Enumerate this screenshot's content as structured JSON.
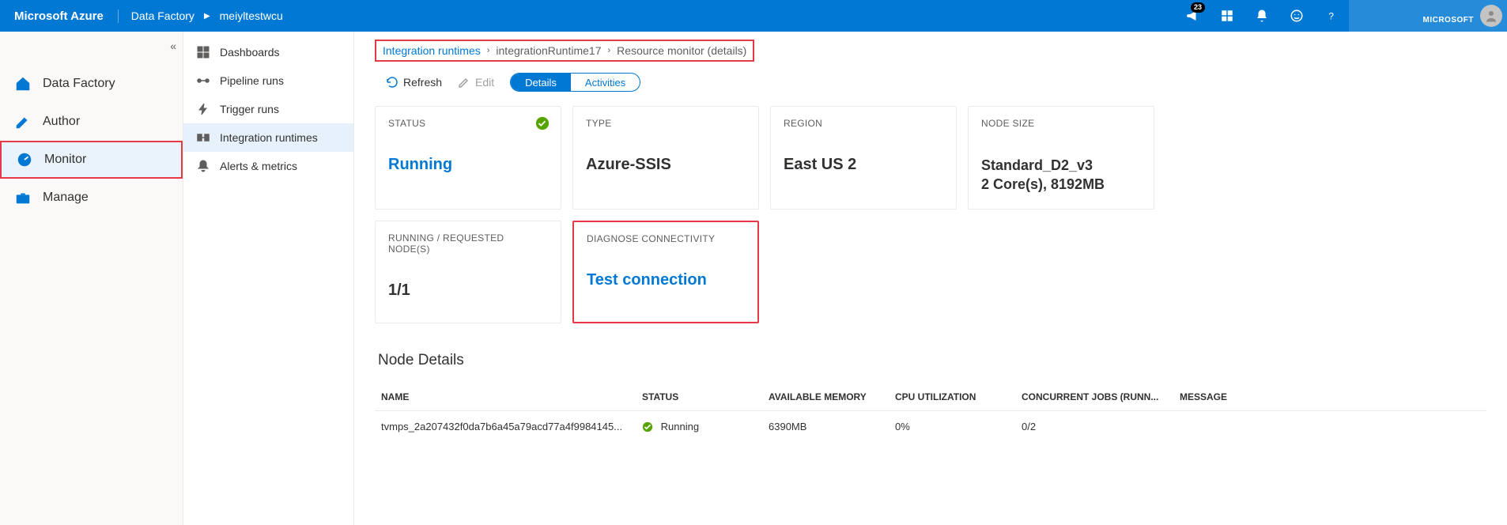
{
  "topbar": {
    "brand": "Microsoft Azure",
    "crumb1": "Data Factory",
    "crumb2": "meiyltestwcu",
    "notif_badge": "23",
    "tenant": "MICROSOFT"
  },
  "leftnav": {
    "items": [
      {
        "icon": "home",
        "label": "Data Factory"
      },
      {
        "icon": "pencil",
        "label": "Author"
      },
      {
        "icon": "gauge",
        "label": "Monitor",
        "active": true
      },
      {
        "icon": "toolbox",
        "label": "Manage"
      }
    ]
  },
  "subnav": {
    "items": [
      {
        "icon": "grid",
        "label": "Dashboards"
      },
      {
        "icon": "pipeline",
        "label": "Pipeline runs"
      },
      {
        "icon": "bolt",
        "label": "Trigger runs"
      },
      {
        "icon": "ir",
        "label": "Integration runtimes",
        "active": true
      },
      {
        "icon": "bell",
        "label": "Alerts & metrics"
      }
    ]
  },
  "breadcrumb": {
    "l1": "Integration runtimes",
    "l2": "integrationRuntime17",
    "l3": "Resource monitor (details)"
  },
  "toolbar": {
    "refresh": "Refresh",
    "edit": "Edit",
    "details": "Details",
    "activities": "Activities"
  },
  "cards": {
    "status_label": "STATUS",
    "status_value": "Running",
    "type_label": "TYPE",
    "type_value": "Azure-SSIS",
    "region_label": "REGION",
    "region_value": "East US 2",
    "nodesize_label": "NODE SIZE",
    "nodesize_value1": "Standard_D2_v3",
    "nodesize_value2": "2 Core(s), 8192MB",
    "runreq_label": "RUNNING / REQUESTED NODE(S)",
    "runreq_value": "1/1",
    "diag_label": "DIAGNOSE CONNECTIVITY",
    "diag_value": "Test connection"
  },
  "node_section_title": "Node Details",
  "node_table": {
    "headers": {
      "name": "NAME",
      "status": "STATUS",
      "mem": "AVAILABLE MEMORY",
      "cpu": "CPU UTILIZATION",
      "jobs": "CONCURRENT JOBS (RUNN...",
      "msg": "MESSAGE"
    },
    "rows": [
      {
        "name": "tvmps_2a207432f0da7b6a45a79acd77a4f9984145...",
        "status": "Running",
        "mem": "6390MB",
        "cpu": "0%",
        "jobs": "0/2",
        "msg": ""
      }
    ]
  }
}
